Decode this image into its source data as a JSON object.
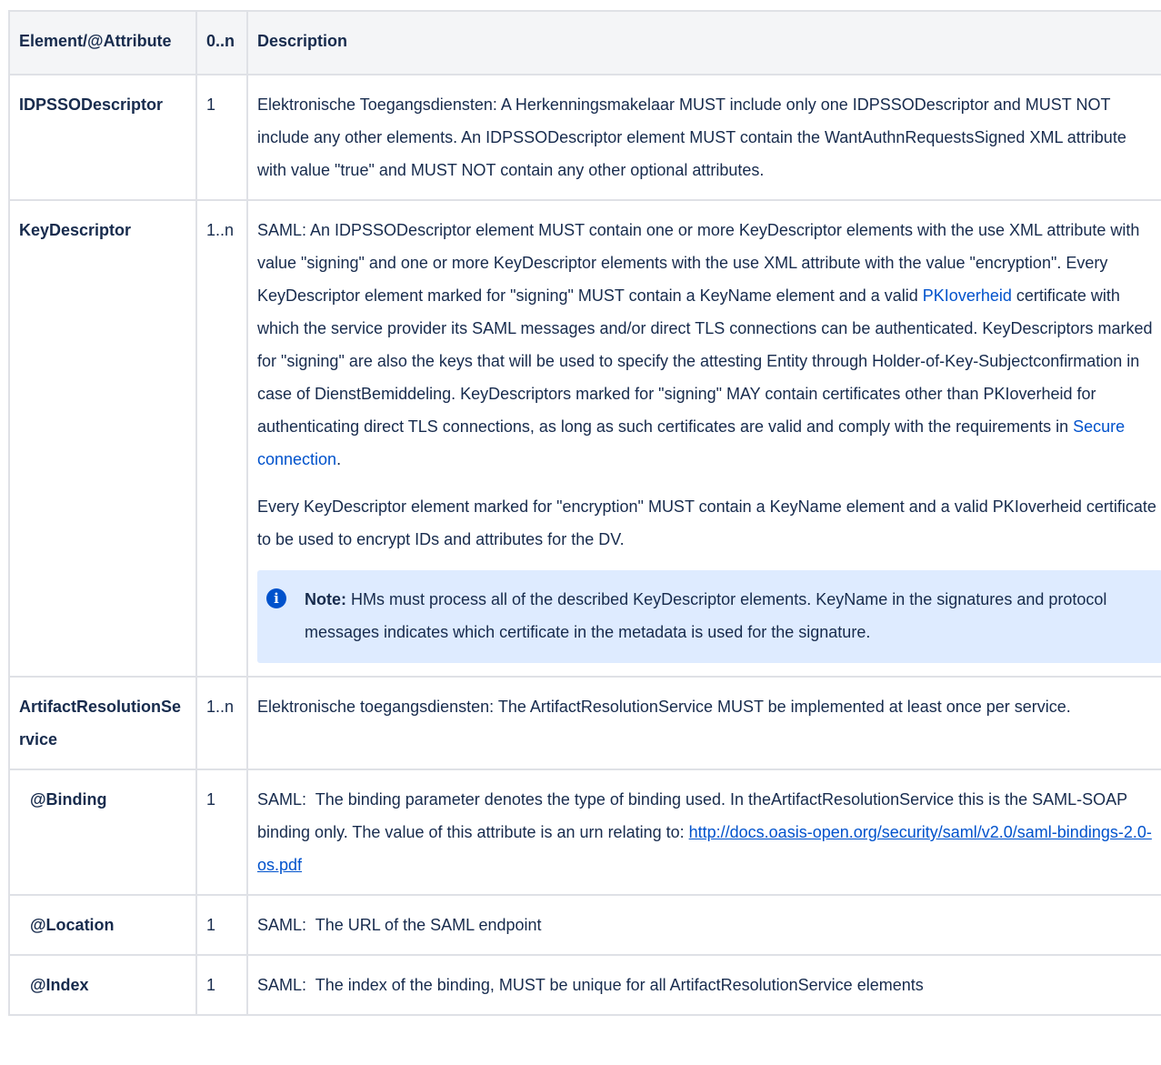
{
  "headers": {
    "element": "Element/@Attribute",
    "cardinality": "0..n",
    "description": "Description"
  },
  "rows": [
    {
      "name": "IDPSSODescriptor",
      "card": "1",
      "desc": "Elektronische Toegangsdiensten: A Herkenningsmakelaar MUST include only one IDPSSODescriptor and MUST NOT include any other elements. An IDPSSODescriptor element MUST contain the WantAuthnRequestsSigned XML attribute with value \"true\" and MUST NOT contain any other optional attributes."
    },
    {
      "name": "KeyDescriptor",
      "card": "1..n",
      "desc_p1_a": "SAML: An IDPSSODescriptor element MUST contain one or more KeyDescriptor elements with the use XML attribute with value \"signing\" and one or more KeyDescriptor elements with the use XML attribute with the value \"encryption\". Every KeyDescriptor element marked for \"signing\" MUST contain a KeyName element and a valid ",
      "desc_p1_link1": "PKIoverheid",
      "desc_p1_b": " certificate with which the service provider its SAML messages and/or direct TLS connections can be authenticated. KeyDescriptors marked for \"signing\" are also the keys that will be used to specify the attesting Entity through Holder-of-Key-Subjectconfirmation in case of DienstBemiddeling. KeyDescriptors marked for \"signing\" MAY contain certificates other than PKIoverheid for authenticating direct TLS connections, as long as such certificates are valid and comply with the requirements in ",
      "desc_p1_link2": "Secure connection",
      "desc_p1_c": ".",
      "desc_p2": "Every KeyDescriptor element marked for \"encryption\" MUST contain a KeyName element and a valid PKIoverheid certificate to be used to encrypt IDs and attributes for the DV.",
      "note_icon": "info-icon",
      "note_label": "Note:",
      "note_text": " HMs must process all of the described KeyDescriptor elements. KeyName in the signatures and protocol messages indicates which certificate in the metadata is used for the signature."
    },
    {
      "name": "ArtifactResolutionService",
      "card": "1..n",
      "desc": "Elektronische toegangsdiensten: The ArtifactResolutionService MUST be implemented at least once per service."
    },
    {
      "name": "@Binding",
      "card": "1",
      "desc": "SAML:  The binding parameter denotes the type of binding used. In theArtifactResolutionService this is the SAML-SOAP binding only. The value of this attribute is an urn relating to: ",
      "link": "http://docs.oasis-open.org/security/saml/v2.0/saml-bindings-2.0-os.pdf"
    },
    {
      "name": "@Location",
      "card": "1",
      "desc": "SAML:  The URL of the SAML endpoint"
    },
    {
      "name": "@Index",
      "card": "1",
      "desc": "SAML:  The index of the binding, MUST be unique for all ArtifactResolutionService elements"
    }
  ],
  "colors": {
    "header_bg": "#f4f5f7",
    "border": "#dfe1e6",
    "link": "#0052cc",
    "note_bg": "#deebff",
    "text": "#172b4d"
  }
}
